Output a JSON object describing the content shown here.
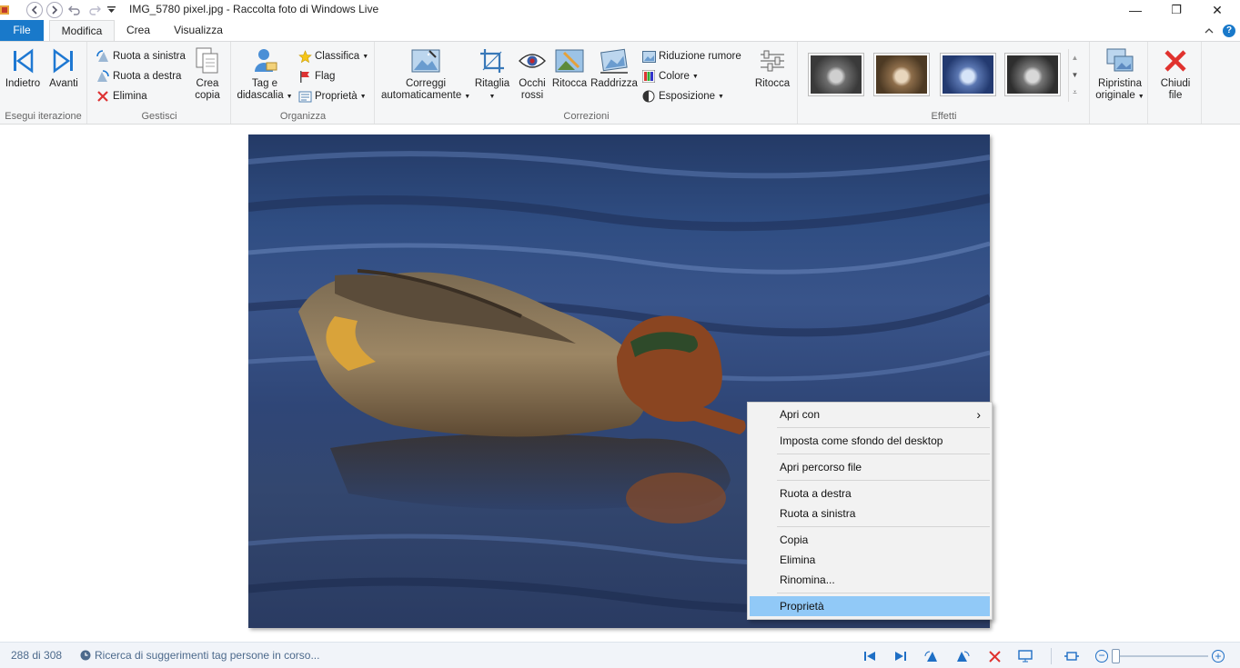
{
  "window": {
    "title": "IMG_5780 pixel.jpg - Raccolta foto di Windows Live",
    "minimize_glyph": "—",
    "maximize_glyph": "❐",
    "close_glyph": "✕",
    "help_glyph": "?"
  },
  "tabs": [
    {
      "label": "File"
    },
    {
      "label": "Modifica"
    },
    {
      "label": "Crea"
    },
    {
      "label": "Visualizza"
    }
  ],
  "ribbon": {
    "groups": {
      "iterate": {
        "label": "Esegui iterazione",
        "back": "Indietro",
        "forward": "Avanti"
      },
      "manage": {
        "label": "Gestisci",
        "rotate_left": "Ruota a sinistra",
        "rotate_right": "Ruota a destra",
        "delete": "Elimina",
        "copy_line1": "Crea",
        "copy_line2": "copia"
      },
      "organize": {
        "label": "Organizza",
        "tag_line1": "Tag e",
        "tag_line2": "didascalia",
        "rating": "Classifica",
        "flag": "Flag",
        "properties": "Proprietà"
      },
      "corrections": {
        "label": "Correzioni",
        "autofix_line1": "Correggi",
        "autofix_line2": "automaticamente",
        "crop": "Ritaglia",
        "redeye_line1": "Occhi",
        "redeye_line2": "rossi",
        "retouch": "Ritocca",
        "straighten": "Raddrizza",
        "noise": "Riduzione rumore",
        "color": "Colore",
        "exposure": "Esposizione",
        "finetune": "Ritocca"
      },
      "effects": {
        "label": "Effetti"
      },
      "revert": {
        "line1": "Ripristina",
        "line2": "originale"
      },
      "close": {
        "line1": "Chiudi",
        "line2": "file"
      }
    }
  },
  "context_menu": {
    "items": [
      {
        "label": "Apri con",
        "submenu": true
      },
      {
        "label": "Imposta come sfondo del desktop"
      },
      {
        "label": "Apri percorso file"
      },
      {
        "label": "Ruota a destra"
      },
      {
        "label": "Ruota a sinistra"
      },
      {
        "label": "Copia"
      },
      {
        "label": "Elimina"
      },
      {
        "label": "Rinomina..."
      },
      {
        "label": "Proprietà",
        "highlighted": true
      }
    ],
    "submenu_arrow": "›"
  },
  "statusbar": {
    "position": "288 di 308",
    "message": "Ricerca di suggerimenti tag persone in corso...",
    "zoom_minus": "−",
    "zoom_plus": "+"
  },
  "colors": {
    "accent": "#1979ca",
    "menu_highlight": "#91c9f7",
    "ribbon_bg": "#f5f6f7",
    "status_text": "#4d6a8c"
  }
}
